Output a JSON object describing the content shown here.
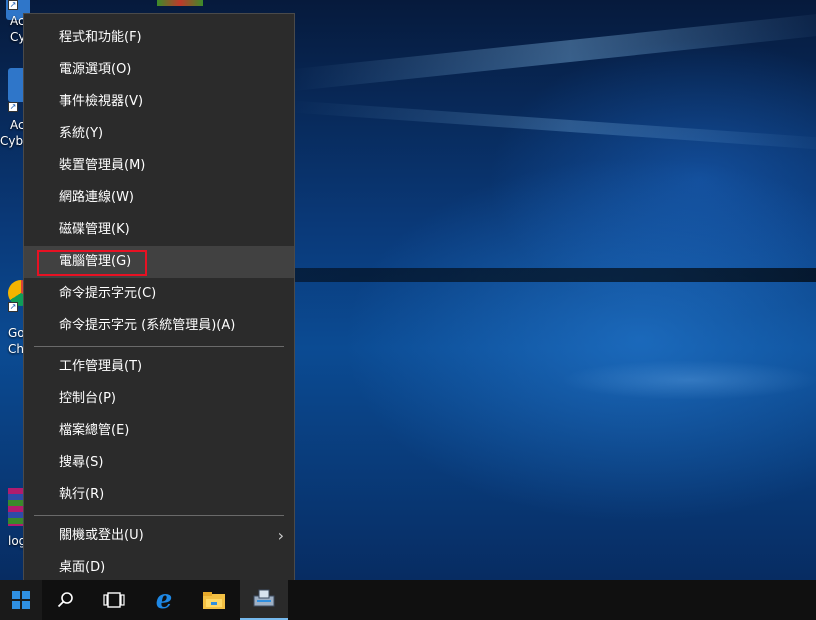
{
  "desktop": {
    "icons": [
      {
        "label_1": "Ac",
        "label_2": "Cy"
      },
      {
        "label_1": "Ac",
        "label_2": "Cybe"
      },
      {
        "label_1": "Go",
        "label_2": "Ch"
      },
      {
        "label_1": "log"
      }
    ]
  },
  "menu": {
    "group1": [
      "程式和功能(F)",
      "電源選項(O)",
      "事件檢視器(V)",
      "系統(Y)",
      "裝置管理員(M)",
      "網路連線(W)",
      "磁碟管理(K)",
      "電腦管理(G)",
      "命令提示字元(C)",
      "命令提示字元 (系統管理員)(A)"
    ],
    "group2": [
      "工作管理員(T)",
      "控制台(P)",
      "檔案總管(E)",
      "搜尋(S)",
      "執行(R)"
    ],
    "group3": [
      "關機或登出(U)",
      "桌面(D)"
    ],
    "selected": "電腦管理(G)"
  },
  "taskbar": {
    "items": [
      "start-icon",
      "search-icon",
      "task-view-icon",
      "edge-icon",
      "file-explorer-icon",
      "server-manager-icon"
    ]
  }
}
